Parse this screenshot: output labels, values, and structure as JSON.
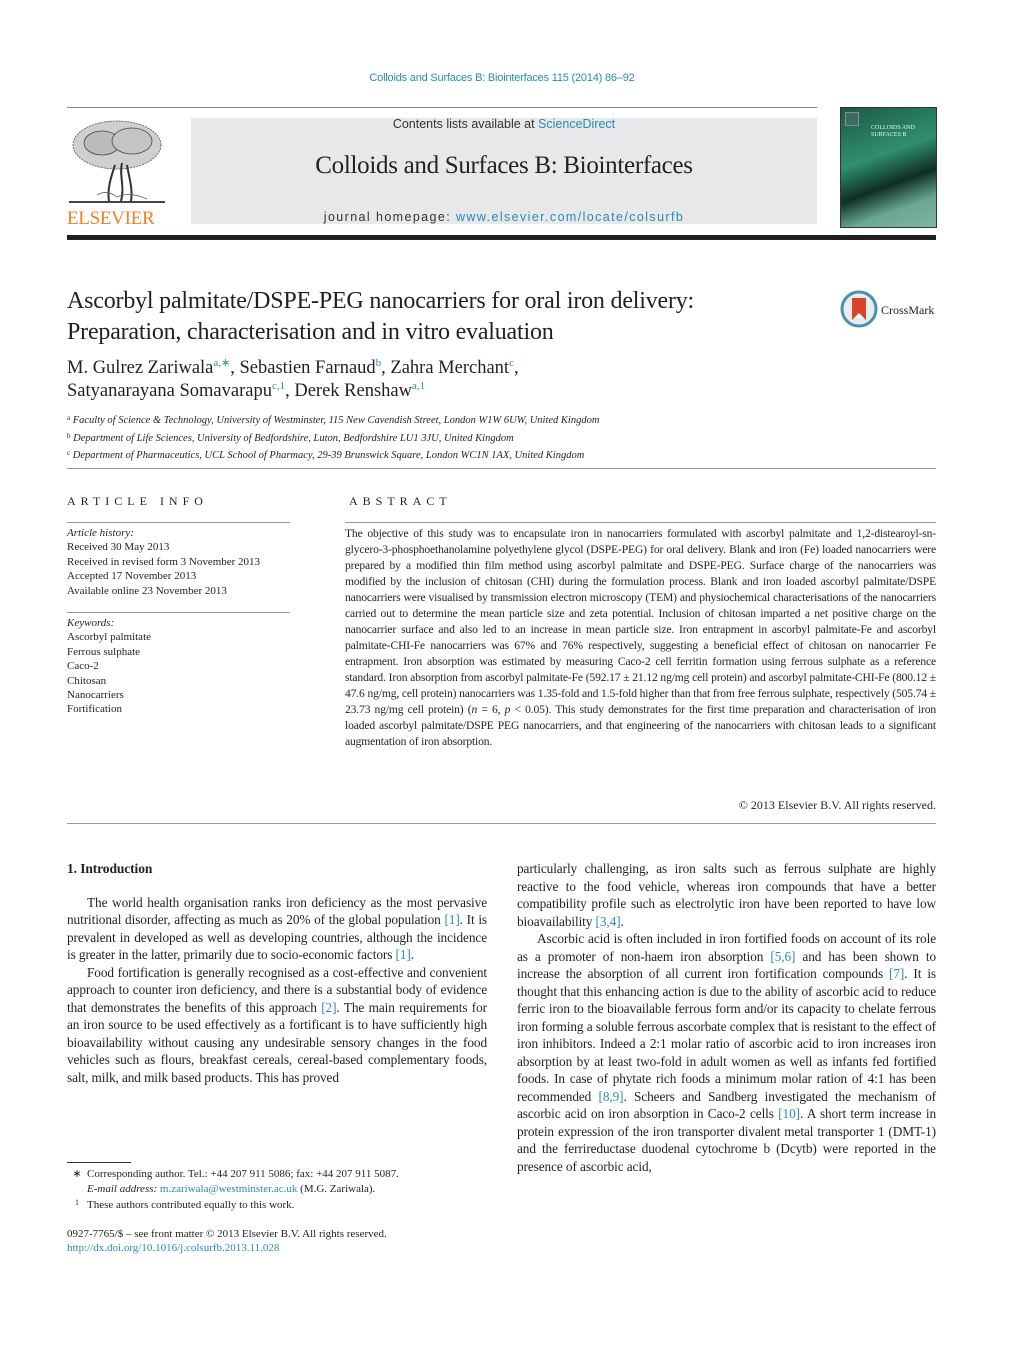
{
  "header": {
    "journal_reference": "Colloids and Surfaces B: Biointerfaces 115 (2014) 86–92",
    "contents_prefix": "Contents lists available at ",
    "contents_link": "ScienceDirect",
    "journal_name": "Colloids and Surfaces B: Biointerfaces",
    "homepage_prefix": "journal homepage: ",
    "homepage_link": "www.elsevier.com/locate/colsurfb",
    "publisher_logo_text": "ELSEVIER",
    "cover_title": "COLLOIDS AND SURFACES B",
    "crossmark_label": "CrossMark"
  },
  "colors": {
    "link": "#2a8ab0",
    "elsevier_orange": "#f47f24",
    "banner_gray": "#e7e8e9",
    "cover_green": "#2f8f6e"
  },
  "article": {
    "title_line1": "Ascorbyl palmitate/DSPE-PEG nanocarriers for oral iron delivery:",
    "title_line2": "Preparation, characterisation and in vitro evaluation",
    "authors": [
      {
        "name": "M. Gulrez Zariwala",
        "sup": "a,∗",
        "sep": ", "
      },
      {
        "name": "Sebastien Farnaud",
        "sup": "b",
        "sep": ", "
      },
      {
        "name": "Zahra Merchant",
        "sup": "c",
        "sep": ","
      },
      {
        "name": "Satyanarayana Somavarapu",
        "sup": "c,1",
        "sep": ", "
      },
      {
        "name": "Derek Renshaw",
        "sup": "a,1",
        "sep": ""
      }
    ],
    "affiliations": [
      {
        "key": "a",
        "text": "Faculty of Science & Technology, University of Westminster, 115 New Cavendish Street, London W1W 6UW, United Kingdom"
      },
      {
        "key": "b",
        "text": "Department of Life Sciences, University of Bedfordshire, Luton, Bedfordshire LU1 3JU, United Kingdom"
      },
      {
        "key": "c",
        "text": "Department of Pharmaceutics, UCL School of Pharmacy, 29-39 Brunswick Square, London WC1N 1AX, United Kingdom"
      }
    ]
  },
  "article_info": {
    "heading": "ARTICLE INFO",
    "history_label": "Article history:",
    "history": [
      "Received 30 May 2013",
      "Received in revised form 3 November 2013",
      "Accepted 17 November 2013",
      "Available online 23 November 2013"
    ],
    "keywords_label": "Keywords:",
    "keywords": [
      "Ascorbyl palmitate",
      "Ferrous sulphate",
      "Caco-2",
      "Chitosan",
      "Nanocarriers",
      "Fortification"
    ]
  },
  "abstract": {
    "heading": "ABSTRACT",
    "text_part1": "The objective of this study was to encapsulate iron in nanocarriers formulated with ascorbyl palmitate and 1,2-distearoyl-sn-glycero-3-phosphoethanolamine polyethylene glycol (DSPE-PEG) for oral delivery. Blank and iron (Fe) loaded nanocarriers were prepared by a modified thin film method using ascorbyl palmitate and DSPE-PEG. Surface charge of the nanocarriers was modified by the inclusion of chitosan (CHI) during the formulation process. Blank and iron loaded ascorbyl palmitate/DSPE nanocarriers were visualised by transmission electron microscopy (TEM) and physiochemical characterisations of the nanocarriers carried out to determine the mean particle size and zeta potential. Inclusion of chitosan imparted a net positive charge on the nanocarrier surface and also led to an increase in mean particle size. Iron entrapment in ascorbyl palmitate-Fe and ascorbyl palmitate-CHI-Fe nanocarriers was 67% and 76% respectively, suggesting a beneficial effect of chitosan on nanocarrier Fe entrapment. Iron absorption was estimated by measuring Caco-2 cell ferritin formation using ferrous sulphate as a reference standard. Iron absorption from ascorbyl palmitate-Fe (592.17 ± 21.12 ng/mg cell protein) and ascorbyl palmitate-CHI-Fe (800.12 ± 47.6 ng/mg, cell protein) nanocarriers was 1.35-fold and 1.5-fold higher than that from free ferrous sulphate, respectively (505.74 ± 23.73 ng/mg cell protein) (",
    "n_sym": "n",
    "text_part2": " = 6, ",
    "p_sym": "p",
    "text_part3": " < 0.05). This study demonstrates for the first time preparation and characterisation of iron loaded ascorbyl palmitate/DSPE PEG nanocarriers, and that engineering of the nanocarriers with chitosan leads to a significant augmentation of iron absorption.",
    "copyright": "© 2013 Elsevier B.V. All rights reserved."
  },
  "introduction": {
    "heading": "1.  Introduction",
    "left": [
      [
        "The world health organisation ranks iron deficiency as the most pervasive nutritional disorder, affecting as much as 20% of the global population ",
        "[1]",
        ". It is prevalent in developed as well as developing countries, although the incidence is greater in the latter, primarily due to socio-economic factors ",
        "[1]",
        "."
      ],
      [
        "Food fortification is generally recognised as a cost-effective and convenient approach to counter iron deficiency, and there is a substantial body of evidence that demonstrates the benefits of this approach ",
        "[2]",
        ". The main requirements for an iron source to be used effectively as a fortificant is to have sufficiently high bioavailability without causing any undesirable sensory changes in the food vehicles such as flours, breakfast cereals, cereal-based complementary foods, salt, milk, and milk based products. This has proved"
      ]
    ],
    "right": [
      [
        "particularly challenging, as iron salts such as ferrous sulphate are highly reactive to the food vehicle, whereas iron compounds that have a better compatibility profile such as electrolytic iron have been reported to have low bioavailability ",
        "[3,4]",
        "."
      ],
      [
        "Ascorbic acid is often included in iron fortified foods on account of its role as a promoter of non-haem iron absorption ",
        "[5,6]",
        " and has been shown to increase the absorption of all current iron fortification compounds ",
        "[7]",
        ". It is thought that this enhancing action is due to the ability of ascorbic acid to reduce ferric iron to the bioavailable ferrous form and/or its capacity to chelate ferrous iron forming a soluble ferrous ascorbate complex that is resistant to the effect of iron inhibitors. Indeed a 2:1 molar ratio of ascorbic acid to iron increases iron absorption by at least two-fold in adult women as well as infants fed fortified foods. In case of phytate rich foods a minimum molar ration of 4:1 has been recommended ",
        "[8,9]",
        ". Scheers and Sandberg investigated the mechanism of ascorbic acid on iron absorption in Caco-2 cells ",
        "[10]",
        ". A short term increase in protein expression of the iron transporter divalent metal transporter 1 (DMT-1) and the ferrireductase duodenal cytochrome b (Dcytb) were reported in the presence of ascorbic acid,"
      ]
    ]
  },
  "footnotes": {
    "corresponding_mark": "∗",
    "corresponding": "Corresponding author. Tel.: +44 207 911 5086; fax: +44 207 911 5087.",
    "email_label": "E-mail address:",
    "email": "m.zariwala@westminster.ac.uk",
    "email_suffix": " (M.G. Zariwala).",
    "equal_mark": "1",
    "equal": "These authors contributed equally to this work.",
    "front_matter": "0927-7765/$ – see front matter © 2013 Elsevier B.V. All rights reserved.",
    "doi": "http://dx.doi.org/10.1016/j.colsurfb.2013.11.028"
  }
}
